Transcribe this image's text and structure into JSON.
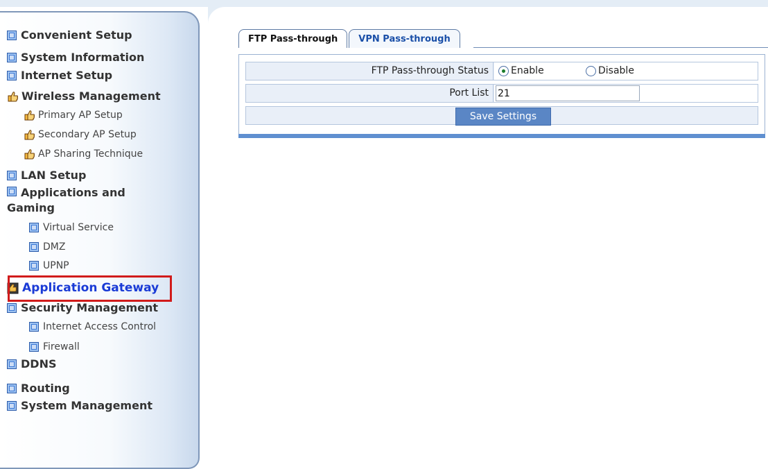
{
  "sidebar": {
    "items": [
      {
        "label": "Convenient Setup",
        "level": 1,
        "icon": "square-icon"
      },
      {
        "label": "System Information",
        "level": 1,
        "icon": "square-icon"
      },
      {
        "label": "Internet Setup",
        "level": 1,
        "icon": "square-icon"
      },
      {
        "label": "Wireless Management",
        "level": 1,
        "icon": "hand-icon"
      },
      {
        "label": "Primary AP Setup",
        "level": 2,
        "icon": "hand-icon"
      },
      {
        "label": "Secondary AP Setup",
        "level": 2,
        "icon": "hand-icon"
      },
      {
        "label": "AP Sharing Technique",
        "level": 2,
        "icon": "hand-icon"
      },
      {
        "label": "LAN Setup",
        "level": 1,
        "icon": "square-icon"
      },
      {
        "label": "Applications and",
        "label2": "Gaming",
        "level": 1,
        "icon": "square-icon"
      },
      {
        "label": "Virtual Service",
        "level": 2,
        "icon": "square-icon"
      },
      {
        "label": "DMZ",
        "level": 2,
        "icon": "square-icon"
      },
      {
        "label": "UPNP",
        "level": 2,
        "icon": "square-icon"
      },
      {
        "label": "Application Gateway",
        "level": 1,
        "icon": "gateway-icon",
        "active": true
      },
      {
        "label": "Security Management",
        "level": 1,
        "icon": "square-icon"
      },
      {
        "label": "Internet Access Control",
        "level": 2,
        "icon": "square-icon"
      },
      {
        "label": "Firewall",
        "level": 2,
        "icon": "square-icon"
      },
      {
        "label": "DDNS",
        "level": 1,
        "icon": "square-icon"
      },
      {
        "label": "Routing",
        "level": 1,
        "icon": "square-icon"
      },
      {
        "label": "System Management",
        "level": 1,
        "icon": "square-icon"
      }
    ]
  },
  "tabs": [
    {
      "label": "FTP Pass-through",
      "active": true
    },
    {
      "label": "VPN Pass-through",
      "active": false
    }
  ],
  "form": {
    "status_label": "FTP Pass-through Status",
    "enable_label": "Enable",
    "disable_label": "Disable",
    "selected": "Enable",
    "port_label": "Port List",
    "port_value": "21",
    "save_label": "Save Settings"
  },
  "colors": {
    "highlight_border": "#d11b1b",
    "active_link": "#1a3bd6",
    "button_bg": "#5a86c5",
    "sidebar_border": "#7f97b9"
  }
}
